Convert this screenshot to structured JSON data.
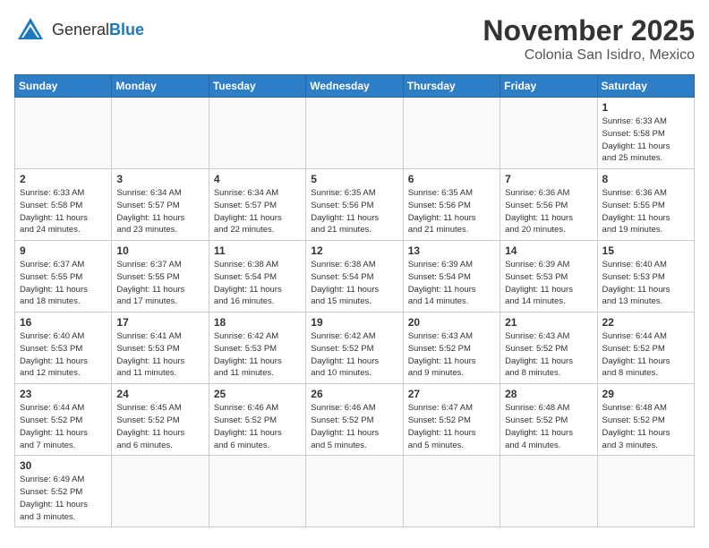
{
  "header": {
    "logo_general": "General",
    "logo_blue": "Blue",
    "month": "November 2025",
    "location": "Colonia San Isidro, Mexico"
  },
  "weekdays": [
    "Sunday",
    "Monday",
    "Tuesday",
    "Wednesday",
    "Thursday",
    "Friday",
    "Saturday"
  ],
  "weeks": [
    [
      {
        "day": "",
        "info": ""
      },
      {
        "day": "",
        "info": ""
      },
      {
        "day": "",
        "info": ""
      },
      {
        "day": "",
        "info": ""
      },
      {
        "day": "",
        "info": ""
      },
      {
        "day": "",
        "info": ""
      },
      {
        "day": "1",
        "info": "Sunrise: 6:33 AM\nSunset: 5:58 PM\nDaylight: 11 hours\nand 25 minutes."
      }
    ],
    [
      {
        "day": "2",
        "info": "Sunrise: 6:33 AM\nSunset: 5:58 PM\nDaylight: 11 hours\nand 24 minutes."
      },
      {
        "day": "3",
        "info": "Sunrise: 6:34 AM\nSunset: 5:57 PM\nDaylight: 11 hours\nand 23 minutes."
      },
      {
        "day": "4",
        "info": "Sunrise: 6:34 AM\nSunset: 5:57 PM\nDaylight: 11 hours\nand 22 minutes."
      },
      {
        "day": "5",
        "info": "Sunrise: 6:35 AM\nSunset: 5:56 PM\nDaylight: 11 hours\nand 21 minutes."
      },
      {
        "day": "6",
        "info": "Sunrise: 6:35 AM\nSunset: 5:56 PM\nDaylight: 11 hours\nand 21 minutes."
      },
      {
        "day": "7",
        "info": "Sunrise: 6:36 AM\nSunset: 5:56 PM\nDaylight: 11 hours\nand 20 minutes."
      },
      {
        "day": "8",
        "info": "Sunrise: 6:36 AM\nSunset: 5:55 PM\nDaylight: 11 hours\nand 19 minutes."
      }
    ],
    [
      {
        "day": "9",
        "info": "Sunrise: 6:37 AM\nSunset: 5:55 PM\nDaylight: 11 hours\nand 18 minutes."
      },
      {
        "day": "10",
        "info": "Sunrise: 6:37 AM\nSunset: 5:55 PM\nDaylight: 11 hours\nand 17 minutes."
      },
      {
        "day": "11",
        "info": "Sunrise: 6:38 AM\nSunset: 5:54 PM\nDaylight: 11 hours\nand 16 minutes."
      },
      {
        "day": "12",
        "info": "Sunrise: 6:38 AM\nSunset: 5:54 PM\nDaylight: 11 hours\nand 15 minutes."
      },
      {
        "day": "13",
        "info": "Sunrise: 6:39 AM\nSunset: 5:54 PM\nDaylight: 11 hours\nand 14 minutes."
      },
      {
        "day": "14",
        "info": "Sunrise: 6:39 AM\nSunset: 5:53 PM\nDaylight: 11 hours\nand 14 minutes."
      },
      {
        "day": "15",
        "info": "Sunrise: 6:40 AM\nSunset: 5:53 PM\nDaylight: 11 hours\nand 13 minutes."
      }
    ],
    [
      {
        "day": "16",
        "info": "Sunrise: 6:40 AM\nSunset: 5:53 PM\nDaylight: 11 hours\nand 12 minutes."
      },
      {
        "day": "17",
        "info": "Sunrise: 6:41 AM\nSunset: 5:53 PM\nDaylight: 11 hours\nand 11 minutes."
      },
      {
        "day": "18",
        "info": "Sunrise: 6:42 AM\nSunset: 5:53 PM\nDaylight: 11 hours\nand 11 minutes."
      },
      {
        "day": "19",
        "info": "Sunrise: 6:42 AM\nSunset: 5:52 PM\nDaylight: 11 hours\nand 10 minutes."
      },
      {
        "day": "20",
        "info": "Sunrise: 6:43 AM\nSunset: 5:52 PM\nDaylight: 11 hours\nand 9 minutes."
      },
      {
        "day": "21",
        "info": "Sunrise: 6:43 AM\nSunset: 5:52 PM\nDaylight: 11 hours\nand 8 minutes."
      },
      {
        "day": "22",
        "info": "Sunrise: 6:44 AM\nSunset: 5:52 PM\nDaylight: 11 hours\nand 8 minutes."
      }
    ],
    [
      {
        "day": "23",
        "info": "Sunrise: 6:44 AM\nSunset: 5:52 PM\nDaylight: 11 hours\nand 7 minutes."
      },
      {
        "day": "24",
        "info": "Sunrise: 6:45 AM\nSunset: 5:52 PM\nDaylight: 11 hours\nand 6 minutes."
      },
      {
        "day": "25",
        "info": "Sunrise: 6:46 AM\nSunset: 5:52 PM\nDaylight: 11 hours\nand 6 minutes."
      },
      {
        "day": "26",
        "info": "Sunrise: 6:46 AM\nSunset: 5:52 PM\nDaylight: 11 hours\nand 5 minutes."
      },
      {
        "day": "27",
        "info": "Sunrise: 6:47 AM\nSunset: 5:52 PM\nDaylight: 11 hours\nand 5 minutes."
      },
      {
        "day": "28",
        "info": "Sunrise: 6:48 AM\nSunset: 5:52 PM\nDaylight: 11 hours\nand 4 minutes."
      },
      {
        "day": "29",
        "info": "Sunrise: 6:48 AM\nSunset: 5:52 PM\nDaylight: 11 hours\nand 3 minutes."
      }
    ],
    [
      {
        "day": "30",
        "info": "Sunrise: 6:49 AM\nSunset: 5:52 PM\nDaylight: 11 hours\nand 3 minutes."
      },
      {
        "day": "",
        "info": ""
      },
      {
        "day": "",
        "info": ""
      },
      {
        "day": "",
        "info": ""
      },
      {
        "day": "",
        "info": ""
      },
      {
        "day": "",
        "info": ""
      },
      {
        "day": "",
        "info": ""
      }
    ]
  ]
}
